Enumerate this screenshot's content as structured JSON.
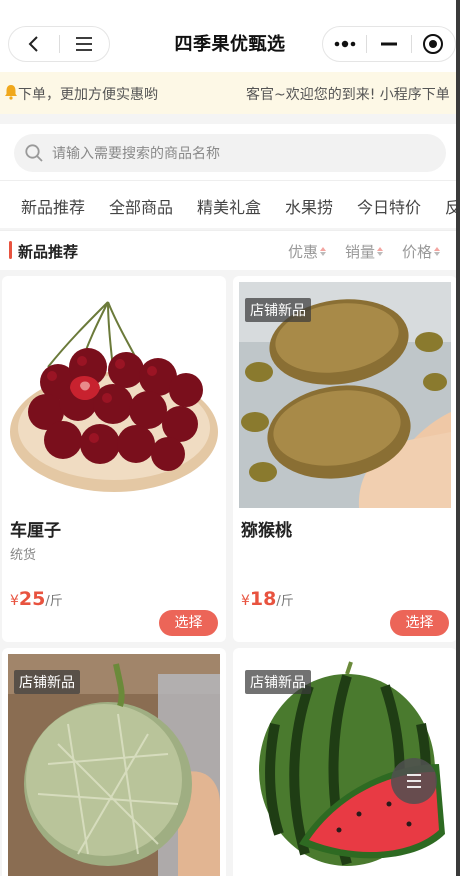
{
  "header": {
    "title": "四季果优甄选",
    "icons": [
      "back-arrow-icon",
      "menu-icon",
      "more-dots-icon",
      "minimize-icon",
      "record-target-icon"
    ]
  },
  "notice": {
    "left_text": "下单，更加方便实惠哟",
    "right_text": "客官~欢迎您的到来! 小程序下单",
    "icon": "bell-icon"
  },
  "search": {
    "placeholder": "请输入需要搜索的商品名称",
    "icon": "search-icon"
  },
  "tabs": [
    "新品推荐",
    "全部商品",
    "精美礼盒",
    "水果捞",
    "今日特价",
    "反"
  ],
  "section": {
    "title": "新品推荐",
    "sorts": [
      "优惠",
      "销量",
      "价格"
    ]
  },
  "products": [
    {
      "name": "车厘子",
      "spec": "统货",
      "currency": "¥",
      "price": "25",
      "unit": "/斤",
      "badge": "",
      "button": "选择"
    },
    {
      "name": "猕猴桃",
      "spec": "",
      "currency": "¥",
      "price": "18",
      "unit": "/斤",
      "badge": "店铺新品",
      "button": "选择"
    },
    {
      "name": "",
      "spec": "",
      "badge": "店铺新品"
    },
    {
      "name": "",
      "spec": "",
      "badge": "店铺新品"
    }
  ],
  "colors": {
    "accent": "#e8533f",
    "button": "#ec6558",
    "notice_bg": "#fdf8e6"
  }
}
